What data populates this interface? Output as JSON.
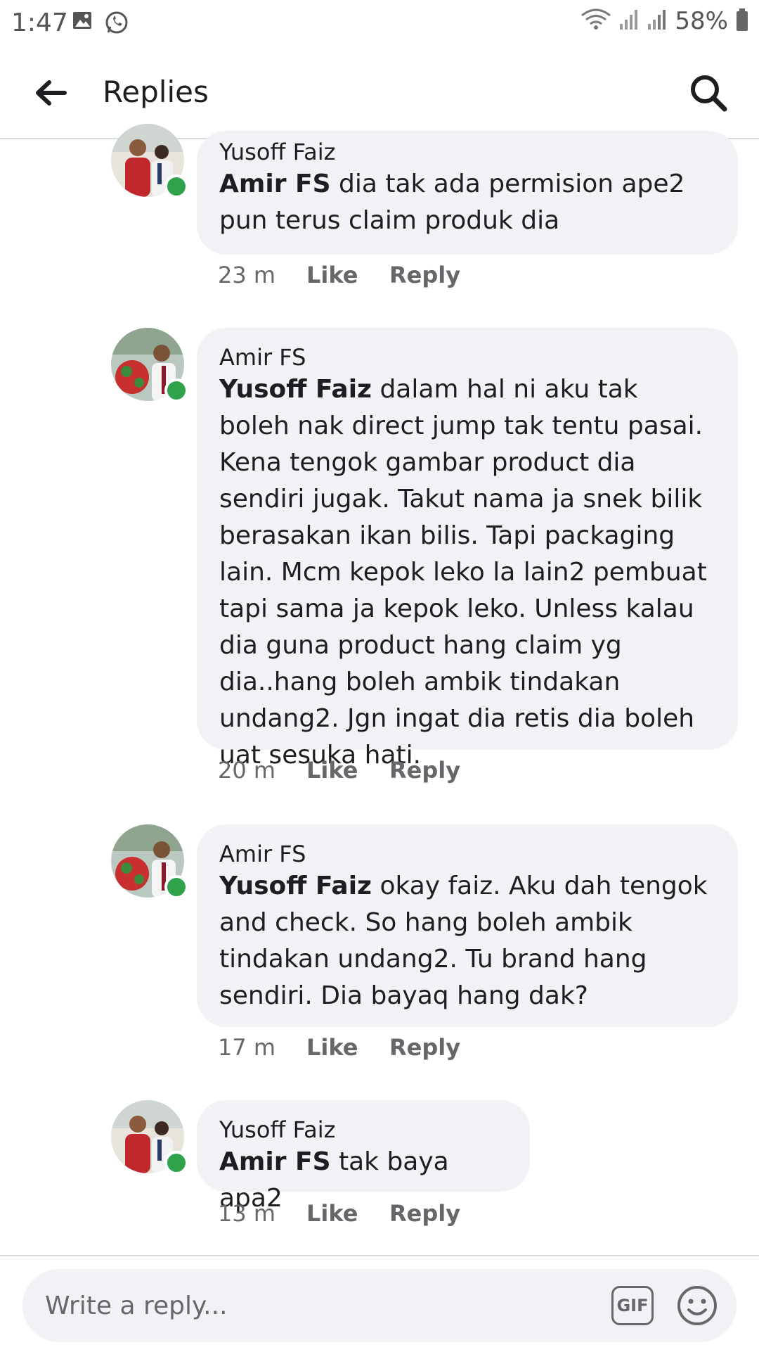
{
  "status_bar": {
    "time": "1:47",
    "battery_percent": "58%",
    "icons": [
      "gallery-icon",
      "whatsapp-icon",
      "wifi-icon",
      "signal-icon",
      "signal-icon",
      "battery-icon"
    ]
  },
  "header": {
    "title": "Replies",
    "back_icon": "arrow-left-icon",
    "search_icon": "search-icon"
  },
  "comments": [
    {
      "author": "Yusoff Faiz",
      "mention": "Amir FS",
      "text": " dia tak ada permision ape2 pun terus claim produk dia",
      "time": "23 m",
      "like_label": "Like",
      "reply_label": "Reply",
      "online": true
    },
    {
      "author": "Amir FS",
      "mention": "Yusoff Faiz",
      "text": " dalam hal ni aku tak boleh nak direct jump tak tentu pasai. Kena tengok gambar product dia sendiri jugak. Takut nama ja snek bilik berasakan ikan bilis. Tapi packaging lain. Mcm kepok leko la lain2 pembuat tapi sama ja kepok leko. Unless kalau dia guna product hang claim yg dia..hang boleh ambik tindakan undang2. Jgn ingat dia retis dia boleh uat sesuka hati.",
      "time": "20 m",
      "like_label": "Like",
      "reply_label": "Reply",
      "online": true
    },
    {
      "author": "Amir FS",
      "mention": "Yusoff Faiz",
      "text": " okay faiz. Aku dah tengok and check. So hang boleh ambik tindakan undang2. Tu brand hang sendiri. Dia bayaq hang dak?",
      "time": "17 m",
      "like_label": "Like",
      "reply_label": "Reply",
      "online": true
    },
    {
      "author": "Yusoff Faiz",
      "mention": "Amir FS",
      "text": " tak baya apa2",
      "time": "13 m",
      "like_label": "Like",
      "reply_label": "Reply",
      "online": true
    }
  ],
  "composer": {
    "placeholder": "Write a reply...",
    "gif_label": "GIF",
    "emoji_icon": "smiley-icon"
  },
  "colors": {
    "bubble": "#f0f2f5",
    "online": "#31a24c",
    "meta_text": "#65676b",
    "divider": "#d8dade"
  }
}
